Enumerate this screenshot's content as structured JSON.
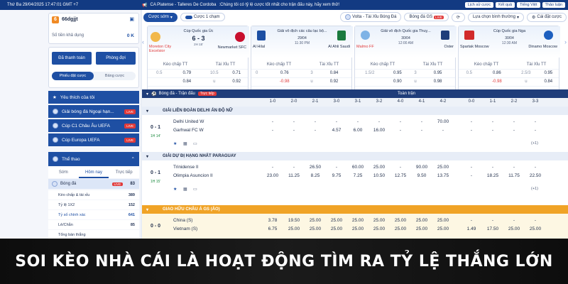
{
  "topbar": {
    "date": "Thứ Ba 29/04/2025 17:47:01 GMT +7",
    "ticker_match": "CA Platense - Talleres De Cordoba",
    "ticker_text": ":Chúng tôi có tỷ lệ cược tốt nhất cho trận đấu này, hãy xem thử!",
    "links": [
      "Lịch sử cược",
      "Kết quả",
      "Tiếng Việt",
      "Thảo luận"
    ]
  },
  "account": {
    "badge": "6",
    "name": "66dgjjt",
    "balance_label": "Số tiền khả dụng",
    "balance": "0 K"
  },
  "quick": {
    "bet_label": "Đã thanh toán",
    "room_label": "Phòng đợi",
    "tab1": "Phiếu đặt cược",
    "tab2": "Bảng cược"
  },
  "nav": [
    {
      "label": "Yêu thích của tôi",
      "badge": ""
    },
    {
      "label": "Giải bóng đá Ngoại hạn...",
      "badge": "LIVE"
    },
    {
      "label": "Cúp C1 Châu Âu UEFA",
      "badge": "LIVE"
    },
    {
      "label": "Cúp Europa UEFA",
      "badge": "LIVE"
    }
  ],
  "sports": {
    "title": "Thể thao",
    "tabs": [
      "Sớm",
      "Hôm nay",
      "Trực tiếp"
    ],
    "item": "Bóng đá",
    "item_count": "83",
    "subs": [
      {
        "label": "Kèo chấp & tài xỉu",
        "n": "389"
      },
      {
        "label": "Tỷ lệ 1X2",
        "n": "152"
      },
      {
        "label": "Tỷ số chính xác",
        "n": "641"
      },
      {
        "label": "Lẻ/Chẵn",
        "n": "85"
      },
      {
        "label": "Tổng bàn thắng",
        "n": ""
      }
    ]
  },
  "toolbar": {
    "bet_live": "Cược sớm",
    "one_click": "Cược 1 chạm",
    "match_chip": "Volta - Tài Xỉu Bóng Đá",
    "sport_chip": "Bóng đá GS",
    "sort": "Lựa chọn bình thường",
    "settings": "Cài đặt cược"
  },
  "cards": [
    {
      "league": "Cúp Quốc gia Úc",
      "home": "Moreton City Excelsior",
      "away": "Newmarket SFC",
      "score": "6 - 3",
      "time": "2H 15'",
      "h1": "Kèo chấp TT",
      "h2": "Tài Xỉu TT",
      "r1": [
        "0.5",
        "0.79",
        "10.5",
        "0.71"
      ],
      "r2": [
        "",
        "0.84",
        "u",
        "0.92"
      ]
    },
    {
      "league": "Giải vô địch các câu lạc bộ...",
      "home": "Al Hilal",
      "away": "Al Ahli Saudi",
      "score": "29/04",
      "time": "11:30 PM",
      "h1": "Kèo chấp TT",
      "h2": "Tài Xỉu TT",
      "r1": [
        "0",
        "0.76",
        "3",
        "0.84"
      ],
      "r2": [
        "",
        "-0.98",
        "u",
        "0.92"
      ]
    },
    {
      "league": "Giải vô địch Quốc gia Thuỵ...",
      "home": "Malmo FF",
      "away": "Oster",
      "score": "30/04",
      "time": "12:00 AM",
      "h1": "Kèo chấp TT",
      "h2": "Tài Xỉu TT",
      "r1": [
        "1.5/2",
        "0.95",
        "3",
        "0.95"
      ],
      "r2": [
        "",
        "0.90",
        "u",
        "0.98"
      ]
    },
    {
      "league": "Cúp Quốc gia Nga",
      "home": "Spartak Moscow",
      "away": "Dinamo Moscow",
      "score": "30/04",
      "time": "12:30 AM",
      "h1": "Kèo chấp TT",
      "h2": "Tài Xỉu TT",
      "r1": [
        "0.5",
        "0.86",
        "2.5/3",
        "0.95"
      ],
      "r2": [
        "",
        "-0.98",
        "u",
        "0.84"
      ]
    }
  ],
  "grid": {
    "section": "Bóng đá - Trận đấu",
    "section_tag": "Trực tiếp",
    "fulltime": "Toàn trận",
    "cols": [
      "1-0",
      "2-0",
      "2-1",
      "3-0",
      "3-1",
      "3-2",
      "4-0",
      "4-1",
      "4-2",
      "0-0",
      "1-1",
      "2-2",
      "3-3"
    ],
    "leagues": [
      {
        "name": "GIẢI LIÊN ĐOÀN DELHI ẤN ĐỘ NỮ",
        "score": "0 - 1",
        "time": "1H 14'",
        "home": "Delhi United W",
        "away": "Garhwal FC W",
        "row1": [
          "",
          "",
          "",
          "",
          "",
          "",
          "",
          "",
          "70.00",
          "",
          "",
          "",
          ""
        ],
        "row2": [
          "",
          "",
          "",
          "4.57",
          "6.00",
          "16.00",
          "",
          "",
          "",
          "",
          "",
          "",
          ""
        ]
      },
      {
        "name": "GIẢI DỰ ĐỊ HẠNG NHẤT PARAGUAY",
        "score": "0 - 1",
        "time": "1H 15'",
        "home": "Trinidense II",
        "away": "Olimpia Asuncion II",
        "row1": [
          "",
          "",
          "26.50",
          "",
          "60.00",
          "25.00",
          "",
          "90.00",
          "25.00",
          "",
          "",
          "",
          ""
        ],
        "row2": [
          "23.00",
          "11.25",
          "8.25",
          "9.75",
          "7.25",
          "10.50",
          "12.75",
          "9.50",
          "13.75",
          "",
          "18.25",
          "11.75",
          "22.50"
        ]
      },
      {
        "name": "GIAO HỮU CHÂU Á GS (ẢO)",
        "score": "0 - 0",
        "time": "",
        "home": "China (S)",
        "away": "Vietnam (S)",
        "row1": [
          "3.78",
          "19.50",
          "25.00",
          "25.00",
          "25.00",
          "25.00",
          "25.00",
          "25.00",
          "25.00",
          "",
          "",
          "",
          ""
        ],
        "row2": [
          "6.75",
          "25.00",
          "25.00",
          "25.00",
          "25.00",
          "25.00",
          "25.00",
          "25.00",
          "25.00",
          "1.49",
          "17.50",
          "25.00",
          "25.00"
        ]
      }
    ],
    "more": "(+1)"
  },
  "banner": "SOI KÈO NHÀ CÁI LÀ HOẠT ĐỘNG TÌM RA TỶ LỆ THẮNG LỚN"
}
